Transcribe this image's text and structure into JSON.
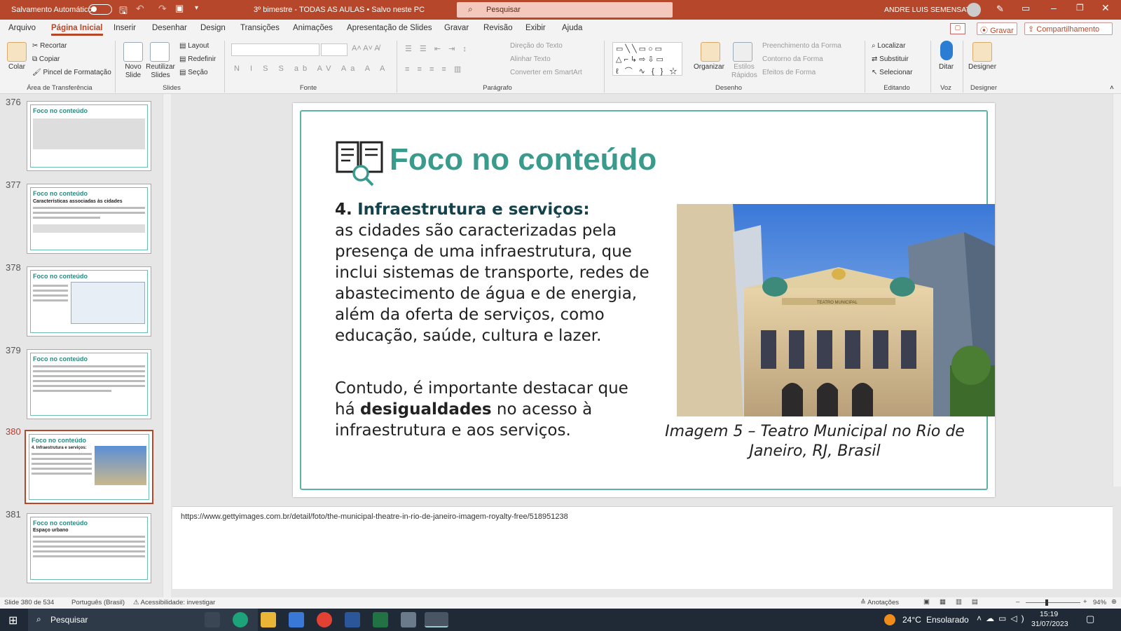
{
  "titlebar": {
    "autosave_label": "Salvamento Automático",
    "doc_title": "3º bimestre - TODAS AS AULAS • Salvo neste PC",
    "search_placeholder": "Pesquisar",
    "user_name": "ANDRE LUIS SEMENSATO"
  },
  "tabs": [
    "Arquivo",
    "Página Inicial",
    "Inserir",
    "Desenhar",
    "Design",
    "Transições",
    "Animações",
    "Apresentação de Slides",
    "Gravar",
    "Revisão",
    "Exibir",
    "Ajuda"
  ],
  "ribbon_right": {
    "record": "Gravar",
    "share": "Compartilhamento"
  },
  "clipboard": {
    "paste": "Colar",
    "cut": "Recortar",
    "copy": "Copiar",
    "format_painter": "Pincel de Formatação",
    "label": "Área de Transferência"
  },
  "slides": {
    "new_slide": "Novo Slide",
    "reuse": "Reutilizar Slides",
    "layout": "Layout",
    "reset": "Redefinir",
    "section": "Seção",
    "label": "Slides"
  },
  "font": {
    "label": "Fonte"
  },
  "paragraph": {
    "text_direction": "Direção do Texto",
    "align_text": "Alinhar Texto",
    "smartart": "Converter em SmartArt",
    "label": "Parágrafo"
  },
  "drawing": {
    "arrange": "Organizar",
    "quick_styles": "Estilos Rápidos",
    "shape_fill": "Preenchimento da Forma",
    "shape_outline": "Contorno da Forma",
    "shape_effects": "Efeitos de Forma",
    "label": "Desenho"
  },
  "editing": {
    "find": "Localizar",
    "replace": "Substituir",
    "select": "Selecionar",
    "label": "Editando"
  },
  "voice": {
    "dictate": "Ditar",
    "label": "Voz"
  },
  "designer": {
    "designer": "Designer",
    "label": "Designer"
  },
  "thumbnails": [
    {
      "num": "376",
      "title": "Foco no conteúdo",
      "subtitle": ""
    },
    {
      "num": "377",
      "title": "Foco no conteúdo",
      "subtitle": "Características associadas às cidades"
    },
    {
      "num": "378",
      "title": "Foco no conteúdo",
      "subtitle": ""
    },
    {
      "num": "379",
      "title": "Foco no conteúdo",
      "subtitle": ""
    },
    {
      "num": "380",
      "title": "Foco no conteúdo",
      "subtitle": "4. Infraestrutura e serviços:"
    },
    {
      "num": "381",
      "title": "Foco no conteúdo",
      "subtitle": "Espaço urbano"
    }
  ],
  "slide": {
    "title": "Foco no conteúdo",
    "heading_num": "4.",
    "heading": "Infraestrutura e serviços:",
    "body1": "as cidades são caracterizadas pela presença de uma infraestrutura, que inclui sistemas de transporte, redes de abastecimento de água e de energia, além da oferta de serviços, como educação, saúde, cultura e lazer.",
    "body2_a": "Contudo, é importante destacar que há ",
    "body2_b": "desigualdades",
    "body2_c": " no acesso à infraestrutura e aos serviços.",
    "caption": "Imagem 5 – Teatro Municipal no Rio de Janeiro, RJ, Brasil",
    "building_sign": "TEATRO MUNICIPAL"
  },
  "notes": "https://www.gettyimages.com.br/detail/foto/the-municipal-theatre-in-rio-de-janeiro-imagem-royalty-free/518951238",
  "status": {
    "slide": "Slide 380 de 534",
    "language": "Português (Brasil)",
    "accessibility": "Acessibilidade: investigar",
    "notes": "Anotações",
    "zoom": "94%"
  },
  "taskbar": {
    "search": "Pesquisar",
    "temp": "24°C",
    "weather": "Ensolarado",
    "time": "15:19",
    "date": "31/07/2023"
  }
}
